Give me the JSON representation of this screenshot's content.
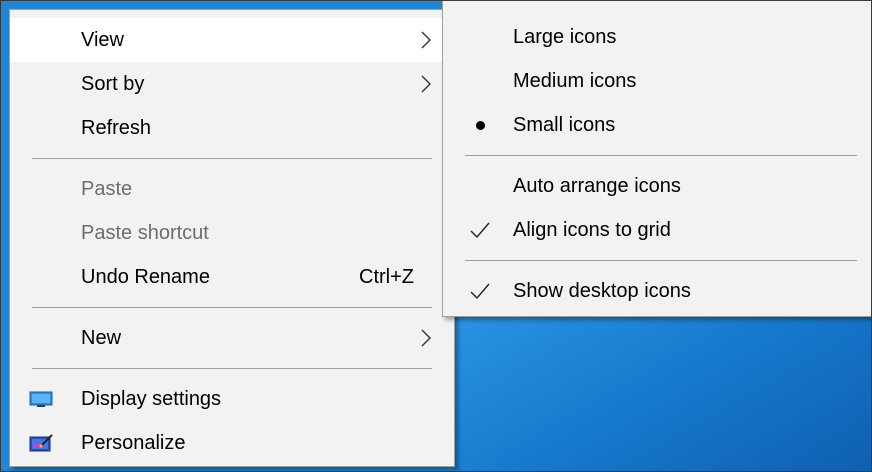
{
  "main_menu": {
    "view": "View",
    "sort_by": "Sort by",
    "refresh": "Refresh",
    "paste": "Paste",
    "paste_shortcut": "Paste shortcut",
    "undo_rename": "Undo Rename",
    "undo_shortcut": "Ctrl+Z",
    "new": "New",
    "display_settings": "Display settings",
    "personalize": "Personalize"
  },
  "view_submenu": {
    "large_icons": "Large icons",
    "medium_icons": "Medium icons",
    "small_icons": "Small icons",
    "auto_arrange": "Auto arrange icons",
    "align_to_grid": "Align icons to grid",
    "show_desktop_icons": "Show desktop icons"
  },
  "icons": {
    "display_settings": "monitor-icon",
    "personalize": "personalize-icon",
    "submenu": "chevron-right-icon",
    "selected": "bullet-icon",
    "checked": "checkmark-icon"
  },
  "colors": {
    "menu_bg": "#f2f2f2",
    "highlight_bg": "#ffffff",
    "disabled_text": "#6d6d6d",
    "desktop_blue": "#1677cc"
  }
}
